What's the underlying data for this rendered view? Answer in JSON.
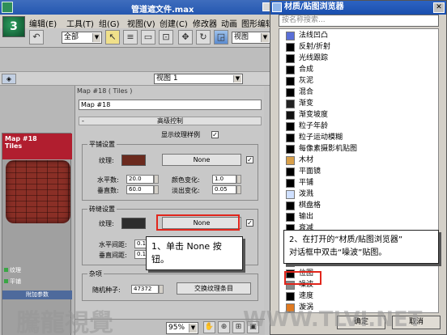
{
  "max": {
    "title": "管道遮文件.max",
    "logo_text": "3",
    "menu": [
      "编辑(E)",
      "工具(T)",
      "组(G)",
      "视图(V)",
      "创建(C)",
      "修改器",
      "动画",
      "图形编辑器"
    ],
    "toolbar": {
      "filter_value": "全部",
      "view_value": "视图"
    },
    "viewbar": {
      "view_label": "视图 1"
    }
  },
  "node": {
    "header": "Map #18\nTiles",
    "labels": [
      "纹理",
      "平铺"
    ],
    "param_label": "附加参数"
  },
  "editor": {
    "title": "Map #18  ( Tiles )",
    "map_name": "Map #18",
    "rollout": "高级控制",
    "show_texture_label": "显示纹理样例",
    "tiles_group": {
      "title": "平铺设置",
      "texture_label": "纹理:",
      "none_label": "None",
      "h_count_label": "水平数:",
      "h_count": "20.0",
      "v_count_label": "垂直数:",
      "v_count": "60.0",
      "color_var_label": "颜色变化:",
      "color_var": "1.0",
      "fade_var_label": "淡出变化:",
      "fade_var": "0.05"
    },
    "grout_group": {
      "title": "砖缝设置",
      "texture_label": "纹理:",
      "none_label": "None",
      "h_gap_label": "水平间距:",
      "h_gap": "0.1",
      "v_gap_label": "垂直间距:",
      "v_gap": "0.1"
    },
    "misc_group": {
      "title": "杂项",
      "seed_label": "随机种子:",
      "seed": "47372",
      "swap_label": "交换纹理条目"
    },
    "zoom": "95%"
  },
  "callouts": {
    "step1": "1、单击 None 按钮。",
    "step2_line1": "2、在打开的“材质/贴图浏览器”",
    "step2_line2": "对话框中双击“噪波”贴图。"
  },
  "browser": {
    "title": "材质/贴图浏览器",
    "search_placeholder": "按名称搜索...",
    "items": [
      {
        "label": "法线凹凸",
        "color": "#5a6fd8"
      },
      {
        "label": "反射/折射",
        "color": "#000000"
      },
      {
        "label": "光线跟踪",
        "color": "#000000"
      },
      {
        "label": "合成",
        "color": "#000000"
      },
      {
        "label": "灰泥",
        "color": "#000000"
      },
      {
        "label": "混合",
        "color": "#000000"
      },
      {
        "label": "渐变",
        "color": "#222222"
      },
      {
        "label": "渐变坡度",
        "color": "#111111"
      },
      {
        "label": "粒子年龄",
        "color": "#000000"
      },
      {
        "label": "粒子运动模糊",
        "color": "#000000"
      },
      {
        "label": "每像素摄影机贴图",
        "color": "#000000"
      },
      {
        "label": "木材",
        "color": "#d9a04a"
      },
      {
        "label": "平面镜",
        "color": "#000000"
      },
      {
        "label": "平铺",
        "color": "#000000"
      },
      {
        "label": "泼溅",
        "color": "#cfe0ff"
      },
      {
        "label": "棋盘格",
        "color": "#000000"
      },
      {
        "label": "输出",
        "color": "#000000"
      },
      {
        "label": "衰减",
        "color": "#000000"
      },
      {
        "label": "",
        "color": "#000000"
      },
      {
        "label": "",
        "color": "#000000"
      },
      {
        "label": "",
        "color": "#000000"
      },
      {
        "label": "位图",
        "color": "#000000"
      },
      {
        "label": "噪波",
        "color": "#888888"
      },
      {
        "label": "速度",
        "color": "#000000"
      },
      {
        "label": "漩涡",
        "color": "#e07a20"
      }
    ],
    "ok_label": "确定",
    "cancel_label": "取消"
  },
  "watermark": {
    "left": "騰龍視覺",
    "right": "WWW.TLVI.NET"
  }
}
